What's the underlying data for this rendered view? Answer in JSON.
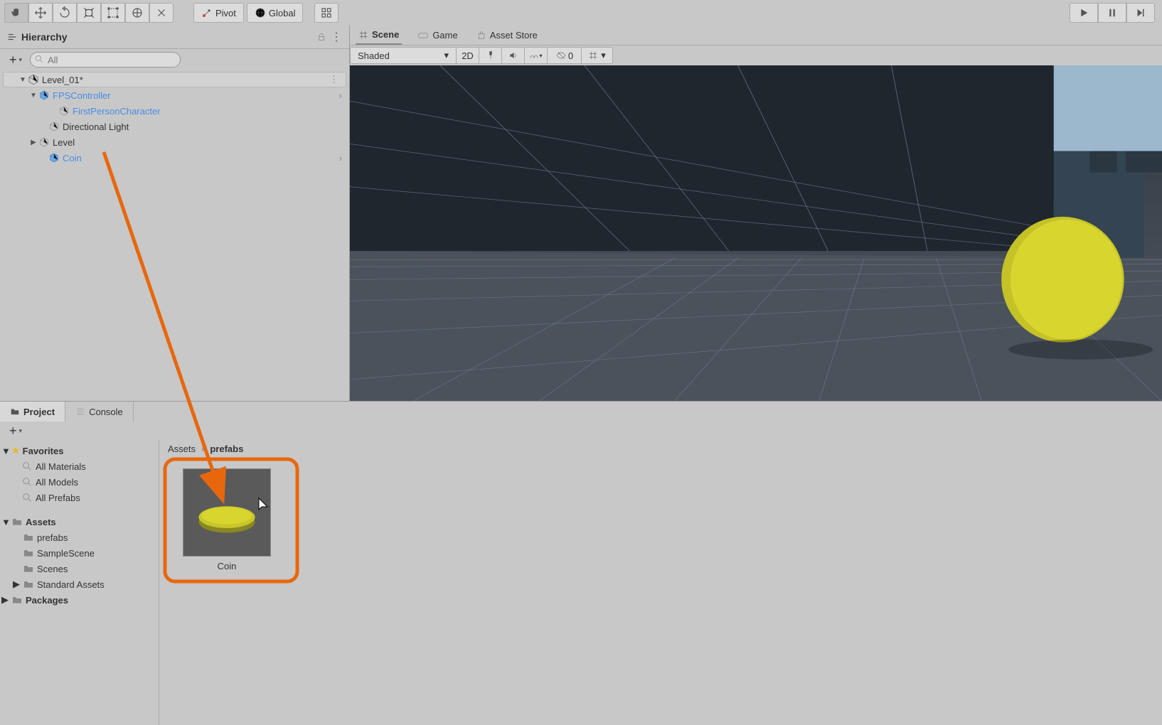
{
  "toolbar": {
    "pivot_label": "Pivot",
    "global_label": "Global"
  },
  "hierarchy": {
    "title": "Hierarchy",
    "search_placeholder": "All",
    "scene": "Level_01*",
    "items": [
      {
        "label": "FPSController",
        "prefab": true,
        "indent": 1,
        "expandable": true,
        "expanded": true,
        "chevron": true
      },
      {
        "label": "FirstPersonCharacter",
        "prefab": true,
        "indent": 2,
        "expandable": false
      },
      {
        "label": "Directional Light",
        "prefab": false,
        "indent": 1,
        "expandable": false
      },
      {
        "label": "Level",
        "prefab": false,
        "indent": 1,
        "expandable": true,
        "expanded": false
      },
      {
        "label": "Coin",
        "prefab": true,
        "indent": 1,
        "expandable": false,
        "chevron": true
      }
    ]
  },
  "scene": {
    "tabs": [
      {
        "label": "Scene",
        "active": true
      },
      {
        "label": "Game",
        "active": false
      },
      {
        "label": "Asset Store",
        "active": false
      }
    ],
    "shading": "Shaded",
    "mode2d": "2D",
    "hidden_count": "0"
  },
  "project": {
    "tabs": [
      {
        "label": "Project",
        "active": true
      },
      {
        "label": "Console",
        "active": false
      }
    ],
    "favorites_label": "Favorites",
    "favorites": [
      "All Materials",
      "All Models",
      "All Prefabs"
    ],
    "assets_label": "Assets",
    "folders": [
      {
        "label": "prefabs",
        "indent": 1,
        "selected": false
      },
      {
        "label": "SampleScene",
        "indent": 1,
        "selected": false
      },
      {
        "label": "Scenes",
        "indent": 1,
        "selected": false
      },
      {
        "label": "Standard Assets",
        "indent": 1,
        "selected": false,
        "expandable": true
      }
    ],
    "packages_label": "Packages",
    "breadcrumb": [
      "Assets",
      "prefabs"
    ],
    "asset": {
      "name": "Coin"
    }
  }
}
